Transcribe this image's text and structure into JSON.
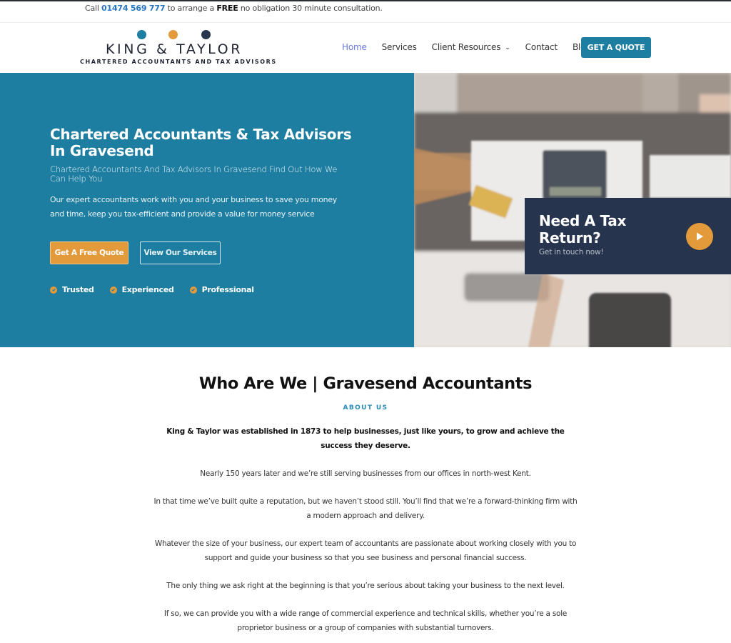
{
  "topbar": {
    "prefix": "Call ",
    "phone": "01474 569 777",
    "middle": " to arrange a ",
    "free": "FREE",
    "suffix": " no obligation 30 minute consultation."
  },
  "logo": {
    "name": "KING & TAYLOR",
    "tagline": "CHARTERED ACCOUNTANTS AND TAX ADVISORS",
    "dot_colors": [
      "#1e7ea1",
      "#e39a3b",
      "#27344d"
    ]
  },
  "nav": {
    "items": [
      {
        "label": "Home",
        "active": true
      },
      {
        "label": "Services"
      },
      {
        "label": "Client Resources",
        "has_dropdown": true
      },
      {
        "label": "Contact"
      },
      {
        "label": "Blog"
      }
    ],
    "cta": "GET A QUOTE",
    "dropdown_glyph": "⌄"
  },
  "hero": {
    "title": "Chartered Accountants & Tax Advisors In Gravesend",
    "subtitle": "Chartered Accountants And Tax Advisors In Gravesend Find Out How We Can Help You",
    "description": "Our expert accountants work with you and your business to save you money and time, keep you tax-efficient and provide a value for money service",
    "primary_button": "Get A Free Quote",
    "secondary_button": "View Our Services",
    "features": [
      "Trusted",
      "Experienced",
      "Professional"
    ]
  },
  "tax_card": {
    "title": "Need A Tax Return?",
    "subtitle": "Get in touch now!"
  },
  "about": {
    "title": "Who Are We | Gravesend Accountants",
    "label": "ABOUT US",
    "paragraphs": [
      "King & Taylor was established in 1873 to help businesses, just like yours, to grow and achieve the success they deserve.",
      "Nearly 150 years later and we’re still serving businesses from our offices in north-west Kent.",
      "In that time we’ve built quite a reputation, but we haven’t stood still. You’ll find that we’re a forward-thinking firm with a modern approach and delivery.",
      "Whatever the size of your business, our expert team of accountants are passionate about working closely with you to support and guide your business so that you see business and personal financial success.",
      "The only thing we ask right at the beginning is that you’re serious about taking your business to the next level.",
      "If so, we can provide you with a wide range of commercial experience and technical skills, whether you’re a sole proprietor business or a group of companies with substantial turnovers."
    ]
  },
  "colors": {
    "brand_blue": "#1e7ea1",
    "accent_orange": "#e39a3b",
    "navy": "#27344d",
    "nav_active": "#6a7bd8",
    "phone_link": "#2575c4"
  }
}
